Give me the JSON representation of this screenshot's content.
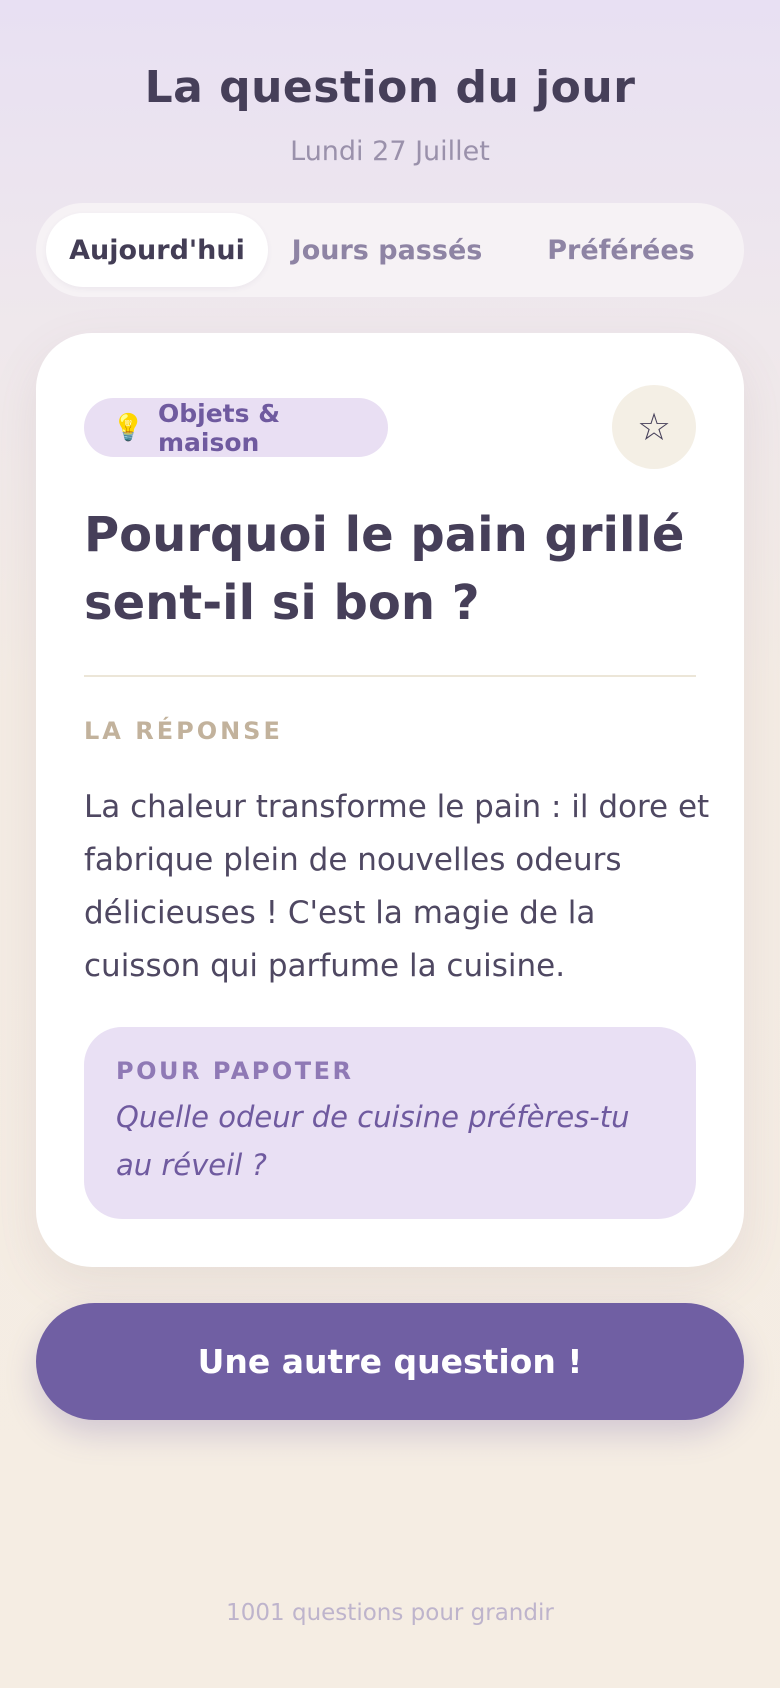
{
  "header": {
    "title": "La question du jour",
    "date": "Lundi 27 Juillet"
  },
  "tabs": [
    {
      "label": "Aujourd'hui",
      "active": true
    },
    {
      "label": "Jours passés",
      "active": false
    },
    {
      "label": "Préférées",
      "active": false
    }
  ],
  "card": {
    "category": {
      "icon": "💡",
      "icon_name": "lightbulb-icon",
      "label": "Objets & maison"
    },
    "favorite_icon": "☆",
    "question": "Pourquoi le pain grillé sent-il si bon ?",
    "answer_label": "LA RÉPONSE",
    "answer": "La chaleur transforme le pain : il dore et fabrique plein de nouvelles odeurs délicieuses ! C'est la magie de la cuisson qui parfume la cuisine.",
    "chat": {
      "label": "POUR PAPOTER",
      "text": "Quelle odeur de cuisine préfères-tu au réveil ?"
    }
  },
  "cta_label": "Une autre question !",
  "footer": "1001 questions pour grandir",
  "colors": {
    "primary": "#705fa3",
    "badge_bg": "#e9dff3",
    "text_dark": "#463f59",
    "answer_label": "#c2b29c"
  }
}
